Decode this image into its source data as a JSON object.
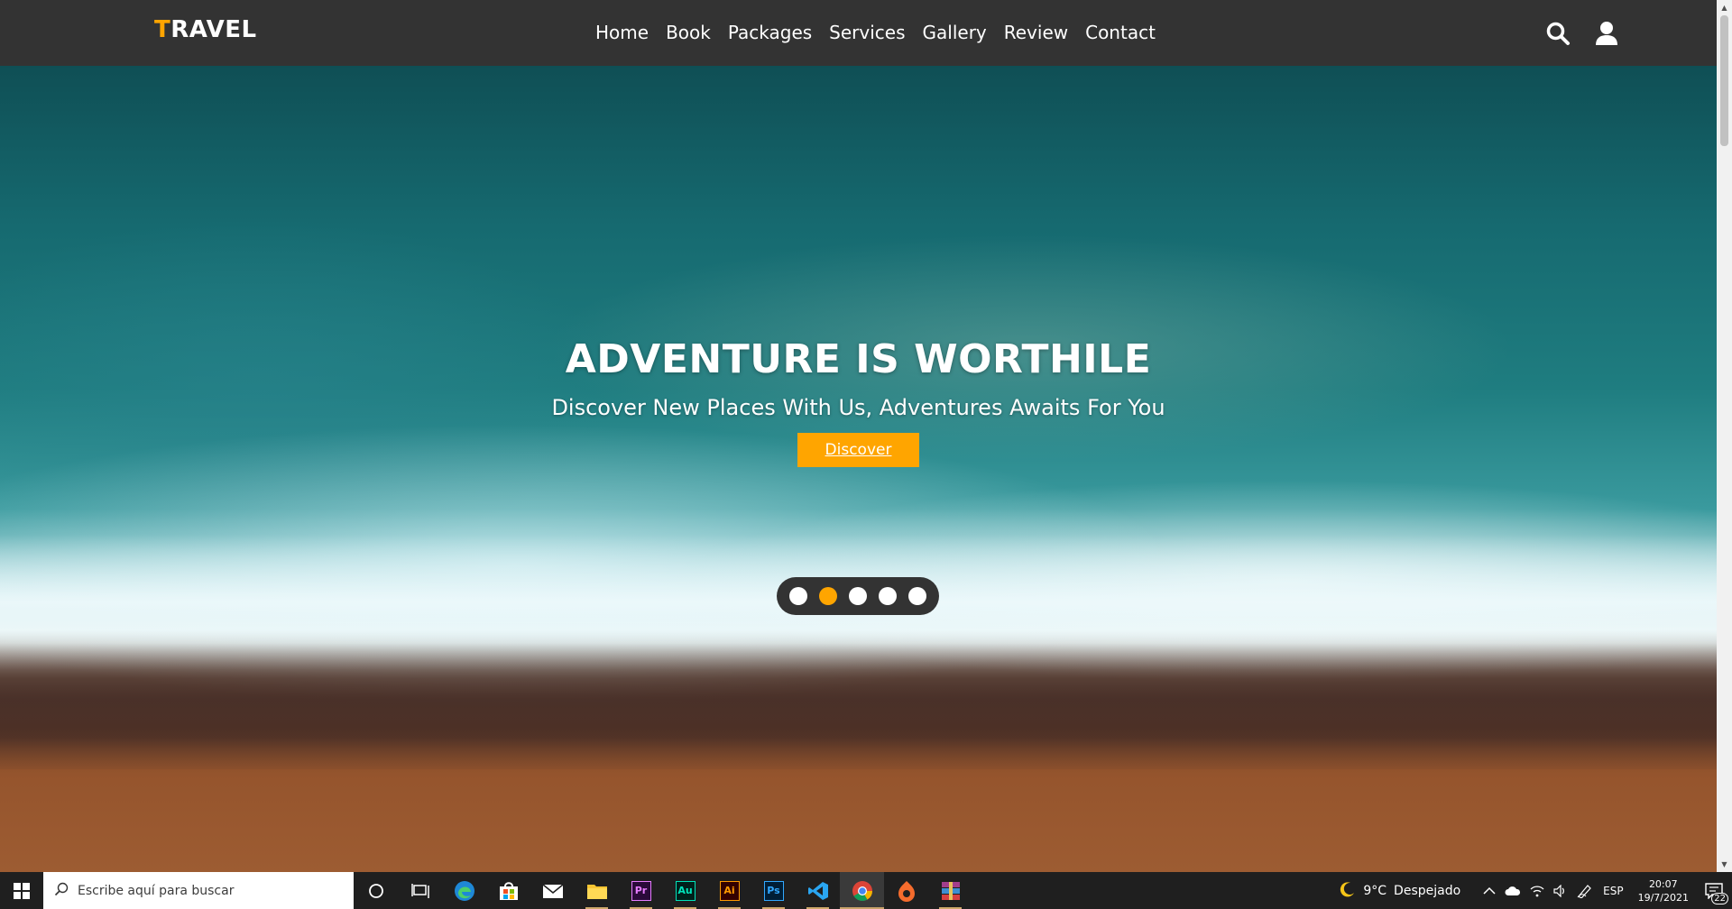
{
  "brand": {
    "first_letter": "T",
    "rest": "RAVEL"
  },
  "nav": {
    "items": [
      "Home",
      "Book",
      "Packages",
      "Services",
      "Gallery",
      "Review",
      "Contact"
    ]
  },
  "header_icons": [
    "search-icon",
    "user-icon"
  ],
  "hero": {
    "title": "ADVENTURE IS WORTHILE",
    "subtitle": "Discover New Places With Us, Adventures Awaits For You",
    "button_label": "Discover",
    "slider_dot_count": 5,
    "active_slide": 2
  },
  "colors": {
    "accent": "#ffa500",
    "header_bg": "#333333",
    "text": "#ffffff"
  },
  "taskbar": {
    "search_placeholder": "Escribe aquí para buscar",
    "apps": [
      {
        "name": "cortana",
        "label": ""
      },
      {
        "name": "task-view",
        "label": ""
      },
      {
        "name": "edge",
        "label": ""
      },
      {
        "name": "store",
        "label": ""
      },
      {
        "name": "mail",
        "label": ""
      },
      {
        "name": "file-explorer",
        "label": ""
      },
      {
        "name": "premiere",
        "label": "Pr"
      },
      {
        "name": "audition",
        "label": "Au"
      },
      {
        "name": "illustrator",
        "label": "Ai"
      },
      {
        "name": "photoshop",
        "label": "Ps"
      },
      {
        "name": "vscode",
        "label": ""
      },
      {
        "name": "chrome",
        "label": ""
      },
      {
        "name": "origin",
        "label": ""
      },
      {
        "name": "winrar",
        "label": ""
      }
    ],
    "weather": {
      "temp": "9°C",
      "condition": "Despejado"
    },
    "language": "ESP",
    "time": "20:07",
    "date": "19/7/2021",
    "notification_count": "22"
  }
}
